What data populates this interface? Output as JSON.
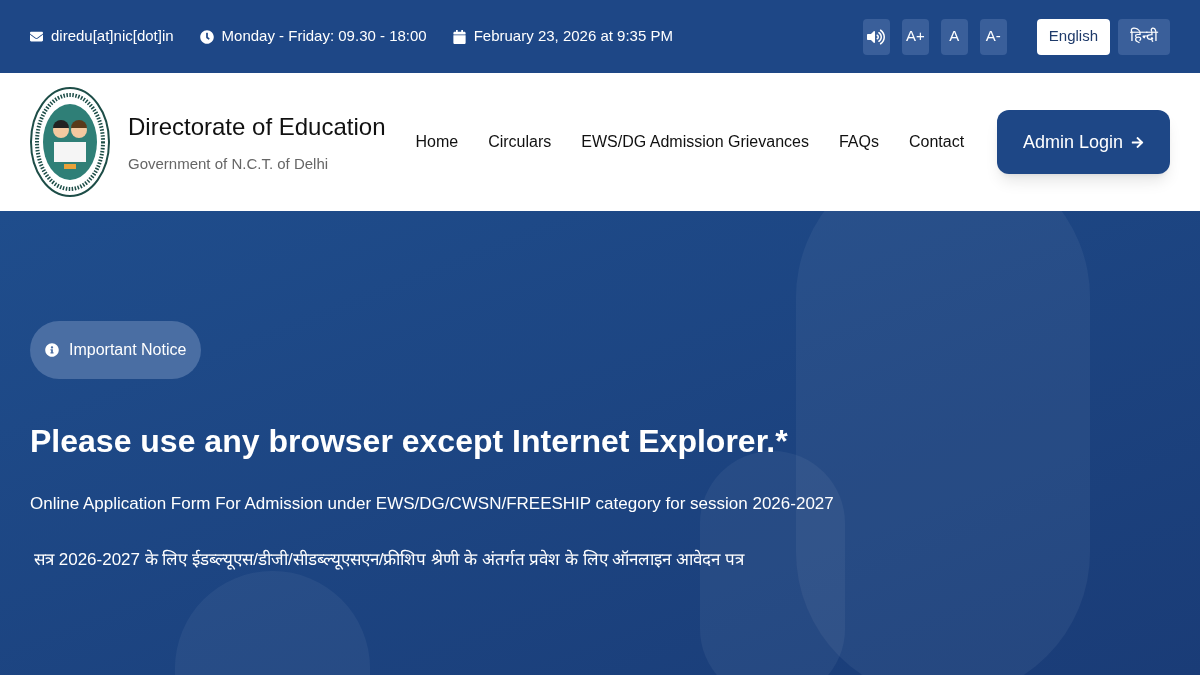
{
  "top_bar": {
    "email": "diredu[at]nic[dot]in",
    "hours": "Monday - Friday: 09.30 - 18:00",
    "date": "February 23, 2026 at 9:35 PM",
    "font_controls": [
      "A+",
      "A",
      "A-"
    ],
    "languages": [
      {
        "label": "English",
        "selected": true
      },
      {
        "label": "हिन्दी",
        "selected": false
      }
    ]
  },
  "header": {
    "title": "Directorate of Education",
    "subtitle": "Government of N.C.T. of Delhi",
    "nav": [
      "Home",
      "Circulars",
      "EWS/DG Admission Grievances",
      "FAQs",
      "Contact"
    ],
    "login_button": "Admin Login"
  },
  "hero": {
    "badge": "Important Notice",
    "heading": "Please use any browser except Internet Explorer.*",
    "text_en": "Online Application Form For Admission under EWS/DG/CWSN/FREESHIP category for session 2026-2027",
    "text_hi": "सत्र 2026-2027 के लिए ईडब्ल्यूएस/डीजी/सीडब्ल्यूएसएन/फ्रीशिप श्रेणी के अंतर्गत प्रवेश के लिए ऑनलाइन आवेदन पत्र"
  }
}
